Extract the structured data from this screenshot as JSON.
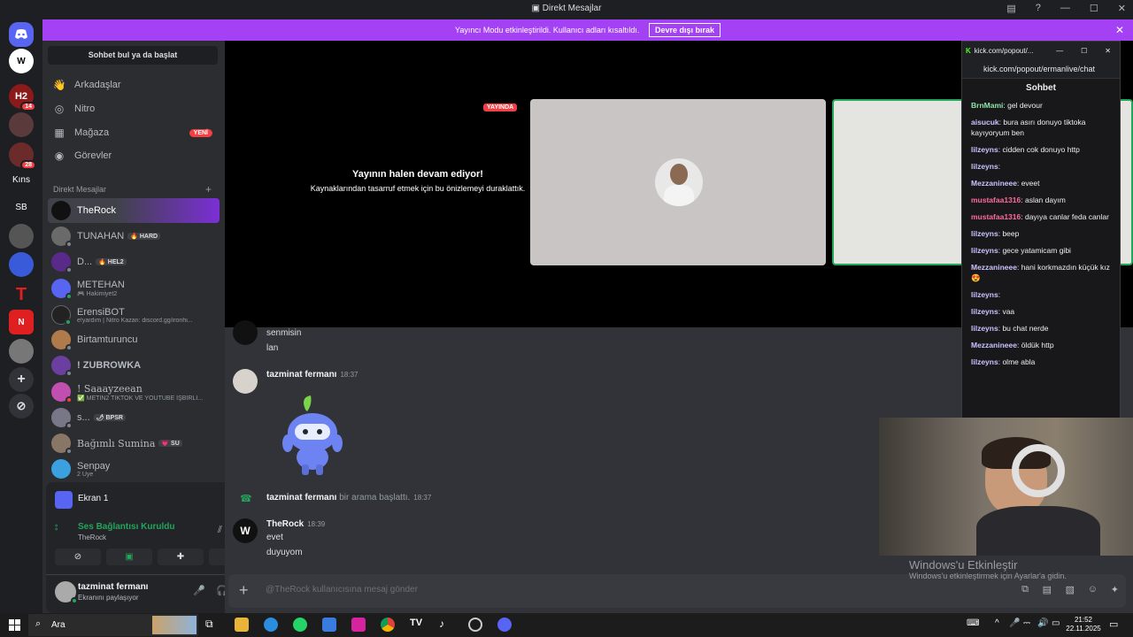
{
  "window": {
    "title": "Direkt Mesajlar"
  },
  "banner": {
    "text": "Yayıncı Modu etkinleştirildi. Kullanıcı adları kısaltıldı.",
    "button": "Devre dışı bırak"
  },
  "guilds": {
    "items": [
      {
        "label": "",
        "badge": "14"
      },
      {
        "label": "",
        "badge": ""
      },
      {
        "label": "",
        "badge": "28"
      },
      {
        "label": "Kıns",
        "badge": ""
      },
      {
        "label": "SB",
        "badge": ""
      }
    ]
  },
  "sidebar": {
    "search": "Sohbet bul ya da başlat",
    "nav": [
      {
        "label": "Arkadaşlar"
      },
      {
        "label": "Nitro"
      },
      {
        "label": "Mağaza",
        "badge": "YENİ"
      },
      {
        "label": "Görevler"
      }
    ],
    "dm_header": "Direkt Mesajlar",
    "dms": [
      {
        "name": "TheRock",
        "sub": "",
        "tag": ""
      },
      {
        "name": "TUNAHAN",
        "sub": "",
        "tag": "🔥 HARD"
      },
      {
        "name": "D...",
        "sub": "",
        "tag": "🔥 HEL2"
      },
      {
        "name": "METEHAN",
        "sub": "🎮 Hakimiyet2",
        "tag": ""
      },
      {
        "name": "ErensiBOT",
        "sub": "e!yardım | Nitro Kazan: discord.gg/ironhi...",
        "tag": ""
      },
      {
        "name": "Birtamturuncu",
        "sub": "",
        "tag": ""
      },
      {
        "name": "! ZUBROWKA",
        "sub": "",
        "tag": ""
      },
      {
        "name": "! Saaayzeean",
        "sub": "✅ METİN2 TİKTOK VE YOUTUBE İŞBİRLİ...",
        "tag": ""
      },
      {
        "name": "s...",
        "sub": "",
        "tag": "🌶 BPSR"
      },
      {
        "name": "Bağımlı Sumina",
        "sub": "",
        "tag": "💗 SU"
      },
      {
        "name": "Senpay",
        "sub": "2 Üye",
        "tag": ""
      }
    ]
  },
  "voice_panel": {
    "screen_label": "Ekran 1",
    "status": "Ses Bağlantısı Kuruldu",
    "channel": "TheRock"
  },
  "user_panel": {
    "name": "tazminat fermanı",
    "status": "Ekranını paylaşıyor"
  },
  "stage": {
    "live_badge": "YAYINDA",
    "paused_title": "Yayının halen devam ediyor!",
    "paused_sub": "Kaynaklarından tasarruf etmek için bu önizlemeyi duraklattık."
  },
  "messages": {
    "prev_lines": [
      "senmisin",
      "lan"
    ],
    "m1": {
      "author": "tazminat fermanı",
      "time": "18:37"
    },
    "call": {
      "author": "tazminat fermanı",
      "text": "bir arama başlattı.",
      "time": "18:37"
    },
    "m2": {
      "author": "TheRock",
      "time": "18:39",
      "lines": [
        "evet",
        "duyuyom"
      ]
    }
  },
  "composer": {
    "placeholder": "@TheRock kullanıcısına mesaj gönder"
  },
  "popout": {
    "tab_title": "kick.com/popout/...",
    "url": "kick.com/popout/ermanlive/chat",
    "header": "Sohbet",
    "messages": [
      {
        "user": "BrnMami",
        "text": "gel devour",
        "color": "#8fe4a8"
      },
      {
        "user": "aisucuk",
        "text": "bura asırı donuyo tiktoka kayıyoryum ben",
        "color": "#c9c4ff"
      },
      {
        "user": "lilzeyns",
        "text": "cidden cok donuyo http",
        "color": "#c9c4ff"
      },
      {
        "user": "lilzeyns",
        "text": "",
        "color": "#c9c4ff"
      },
      {
        "user": "Mezzanineee",
        "text": "eveet",
        "color": "#c9c4ff"
      },
      {
        "user": "mustafaa1316",
        "text": "aslan dayım",
        "color": "#ff6b9a"
      },
      {
        "user": "mustafaa1316",
        "text": "dayıya canlar feda canlar",
        "color": "#ff6b9a"
      },
      {
        "user": "lilzeyns",
        "text": "beep",
        "color": "#c9c4ff"
      },
      {
        "user": "lilzeyns",
        "text": "gece yatamicam gibi",
        "color": "#c9c4ff"
      },
      {
        "user": "Mezzanineee",
        "text": "hani korkmazdın küçük kız 😍",
        "color": "#c9c4ff"
      },
      {
        "user": "lilzeyns",
        "text": "",
        "color": "#c9c4ff"
      },
      {
        "user": "lilzeyns",
        "text": "vaa",
        "color": "#c9c4ff"
      },
      {
        "user": "lilzeyns",
        "text": "bu chat nerde",
        "color": "#c9c4ff"
      },
      {
        "user": "Mezzanineee",
        "text": "öldük http",
        "color": "#c9c4ff"
      },
      {
        "user": "lilzeyns",
        "text": "olme abla",
        "color": "#c9c4ff"
      }
    ]
  },
  "watermark": {
    "title": "Windows'u Etkinleştir",
    "sub": "Windows'u etkinleştirmek için Ayarlar'a gidin."
  },
  "taskbar": {
    "search": "Ara",
    "time": "21:52",
    "date": "22.11.2025"
  }
}
